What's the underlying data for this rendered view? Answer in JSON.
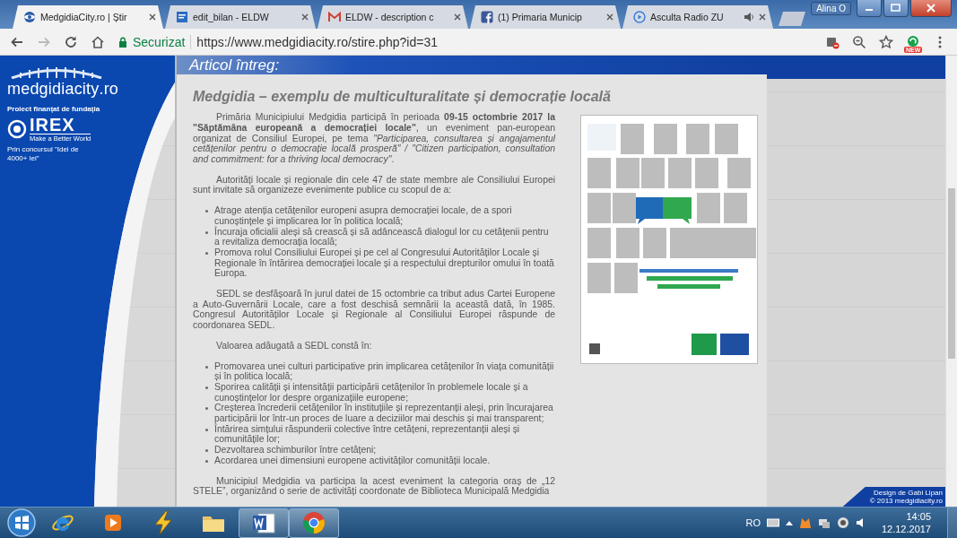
{
  "window": {
    "user": "Alina O"
  },
  "tabs": [
    {
      "title": "MedgidiaCity.ro | Știr",
      "kind": "site",
      "selected": true,
      "playing_audio": false
    },
    {
      "title": "edit_bilan - ELDW",
      "kind": "doc",
      "selected": false,
      "playing_audio": false
    },
    {
      "title": "ELDW - description c",
      "kind": "mail",
      "selected": false,
      "playing_audio": false
    },
    {
      "title": "(1) Primaria Municip",
      "kind": "social",
      "selected": false,
      "playing_audio": false
    },
    {
      "title": "Asculta Radio ZU",
      "kind": "radio",
      "selected": false,
      "playing_audio": true
    }
  ],
  "toolbar": {
    "security_label": "Securizat",
    "url": "https://www.medgidiacity.ro/stire.php?id=31",
    "extension_badge": "NEW"
  },
  "sidebar": {
    "logo": "medgidia**city**.ro",
    "funding_note": "Proiect finanțat de fundația",
    "sponsor": "IREX",
    "sponsor_tagline": "Make a Better World",
    "contest_note": "Prin concursul \"Idei de 4000+ lei\""
  },
  "article": {
    "section_title": "Articol întreg:",
    "title": "Medgidia – exemplu de multiculturalitate și democrație locală",
    "blocks": [
      {
        "kind": "paragraph",
        "text": "Primăria Municipiului Medgidia participă în perioada **09-15 octombrie 2017 la \"Săptămâna europeană a democrației locale\"**, un eveniment pan-european organizat de Consiliul Europei, pe tema *\"Participarea, consultarea și angajamentul cetățenilor pentru o democrație locală prosperă\" / \"Citizen participation, consultation and commitment: for a thriving local democracy\"*."
      },
      {
        "kind": "paragraph",
        "text": "Autorități locale și regionale din cele 47 de state membre ale Consiliului Europei sunt invitate să organizeze evenimente publice cu scopul de a:"
      },
      {
        "kind": "list",
        "items": [
          "Atrage atenția cetățenilor europeni asupra democrației locale, de a spori cunoștințele și implicarea lor în politica locală;",
          "Încuraja oficialii aleși să crească și să adâncească dialogul lor cu cetățenii pentru a revitaliza democrația locală;",
          "Promova rolul Consiliului Europei și pe cel al Congresului Autorităților Locale și Regionale în întărirea democrației locale și a respectului drepturilor omului în toată Europa."
        ]
      },
      {
        "kind": "paragraph",
        "text": "SEDL se desfășoară în jurul datei de 15 octombrie ca tribut adus Cartei Europene a Auto-Guvernării Locale, care a fost deschisă semnării la această dată, în 1985. Congresul Autorităților Locale și Regionale al Consiliului Europei răspunde de coordonarea SEDL."
      },
      {
        "kind": "paragraph",
        "text": "Valoarea adăugată a SEDL constă în:"
      },
      {
        "kind": "list",
        "items": [
          "Promovarea unei culturi participative prin implicarea cetățenilor în viața comunității și în politica locală;",
          "Sporirea calității și intensității participării cetățenilor în problemele locale și a cunoștințelor lor despre organizațiile europene;",
          "Creșterea încrederii cetățenilor în instituțiile și reprezentanții aleși, prin încurajarea participării lor într-un proces de luare a deciziilor mai deschis și mai transparent;",
          "Întărirea simțului răspunderii colective între cetățeni, reprezentanții aleși și comunitățile lor;",
          "Dezvoltarea schimburilor între cetățeni;",
          "Acordarea unei dimensiuni europene activităților comunității locale."
        ]
      },
      {
        "kind": "paragraph",
        "text": "Municipiul Medgidia va participa la acest eveniment la categoria oraș de „12 STELE”, organizând o serie de activități coordonate de Biblioteca Municipală Medgidia"
      }
    ]
  },
  "footer_credit": {
    "designer": "Design de Gabi Lipan",
    "copyright": "© 2013 medgidiacity.ro"
  },
  "taskbar": {
    "apps": [
      {
        "kind": "browser-e",
        "running": false
      },
      {
        "kind": "player",
        "running": false
      },
      {
        "kind": "bolt",
        "running": false
      },
      {
        "kind": "folder",
        "running": false
      },
      {
        "kind": "word",
        "running": true
      },
      {
        "kind": "chrome",
        "running": true
      }
    ],
    "language": "RO",
    "time": "14:05",
    "date": "12.12.2017"
  }
}
